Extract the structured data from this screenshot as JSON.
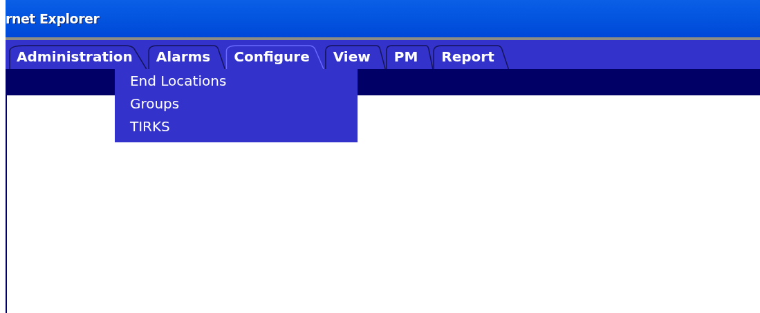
{
  "window": {
    "title": "rnet Explorer"
  },
  "tabs": [
    {
      "label": "Administration",
      "selected": false
    },
    {
      "label": "Alarms",
      "selected": false
    },
    {
      "label": "Configure",
      "selected": true
    },
    {
      "label": "View",
      "selected": false
    },
    {
      "label": "PM",
      "selected": false
    },
    {
      "label": "Report",
      "selected": false
    }
  ],
  "menu": {
    "items": [
      "End Locations",
      "Groups",
      "TIRKS"
    ]
  }
}
